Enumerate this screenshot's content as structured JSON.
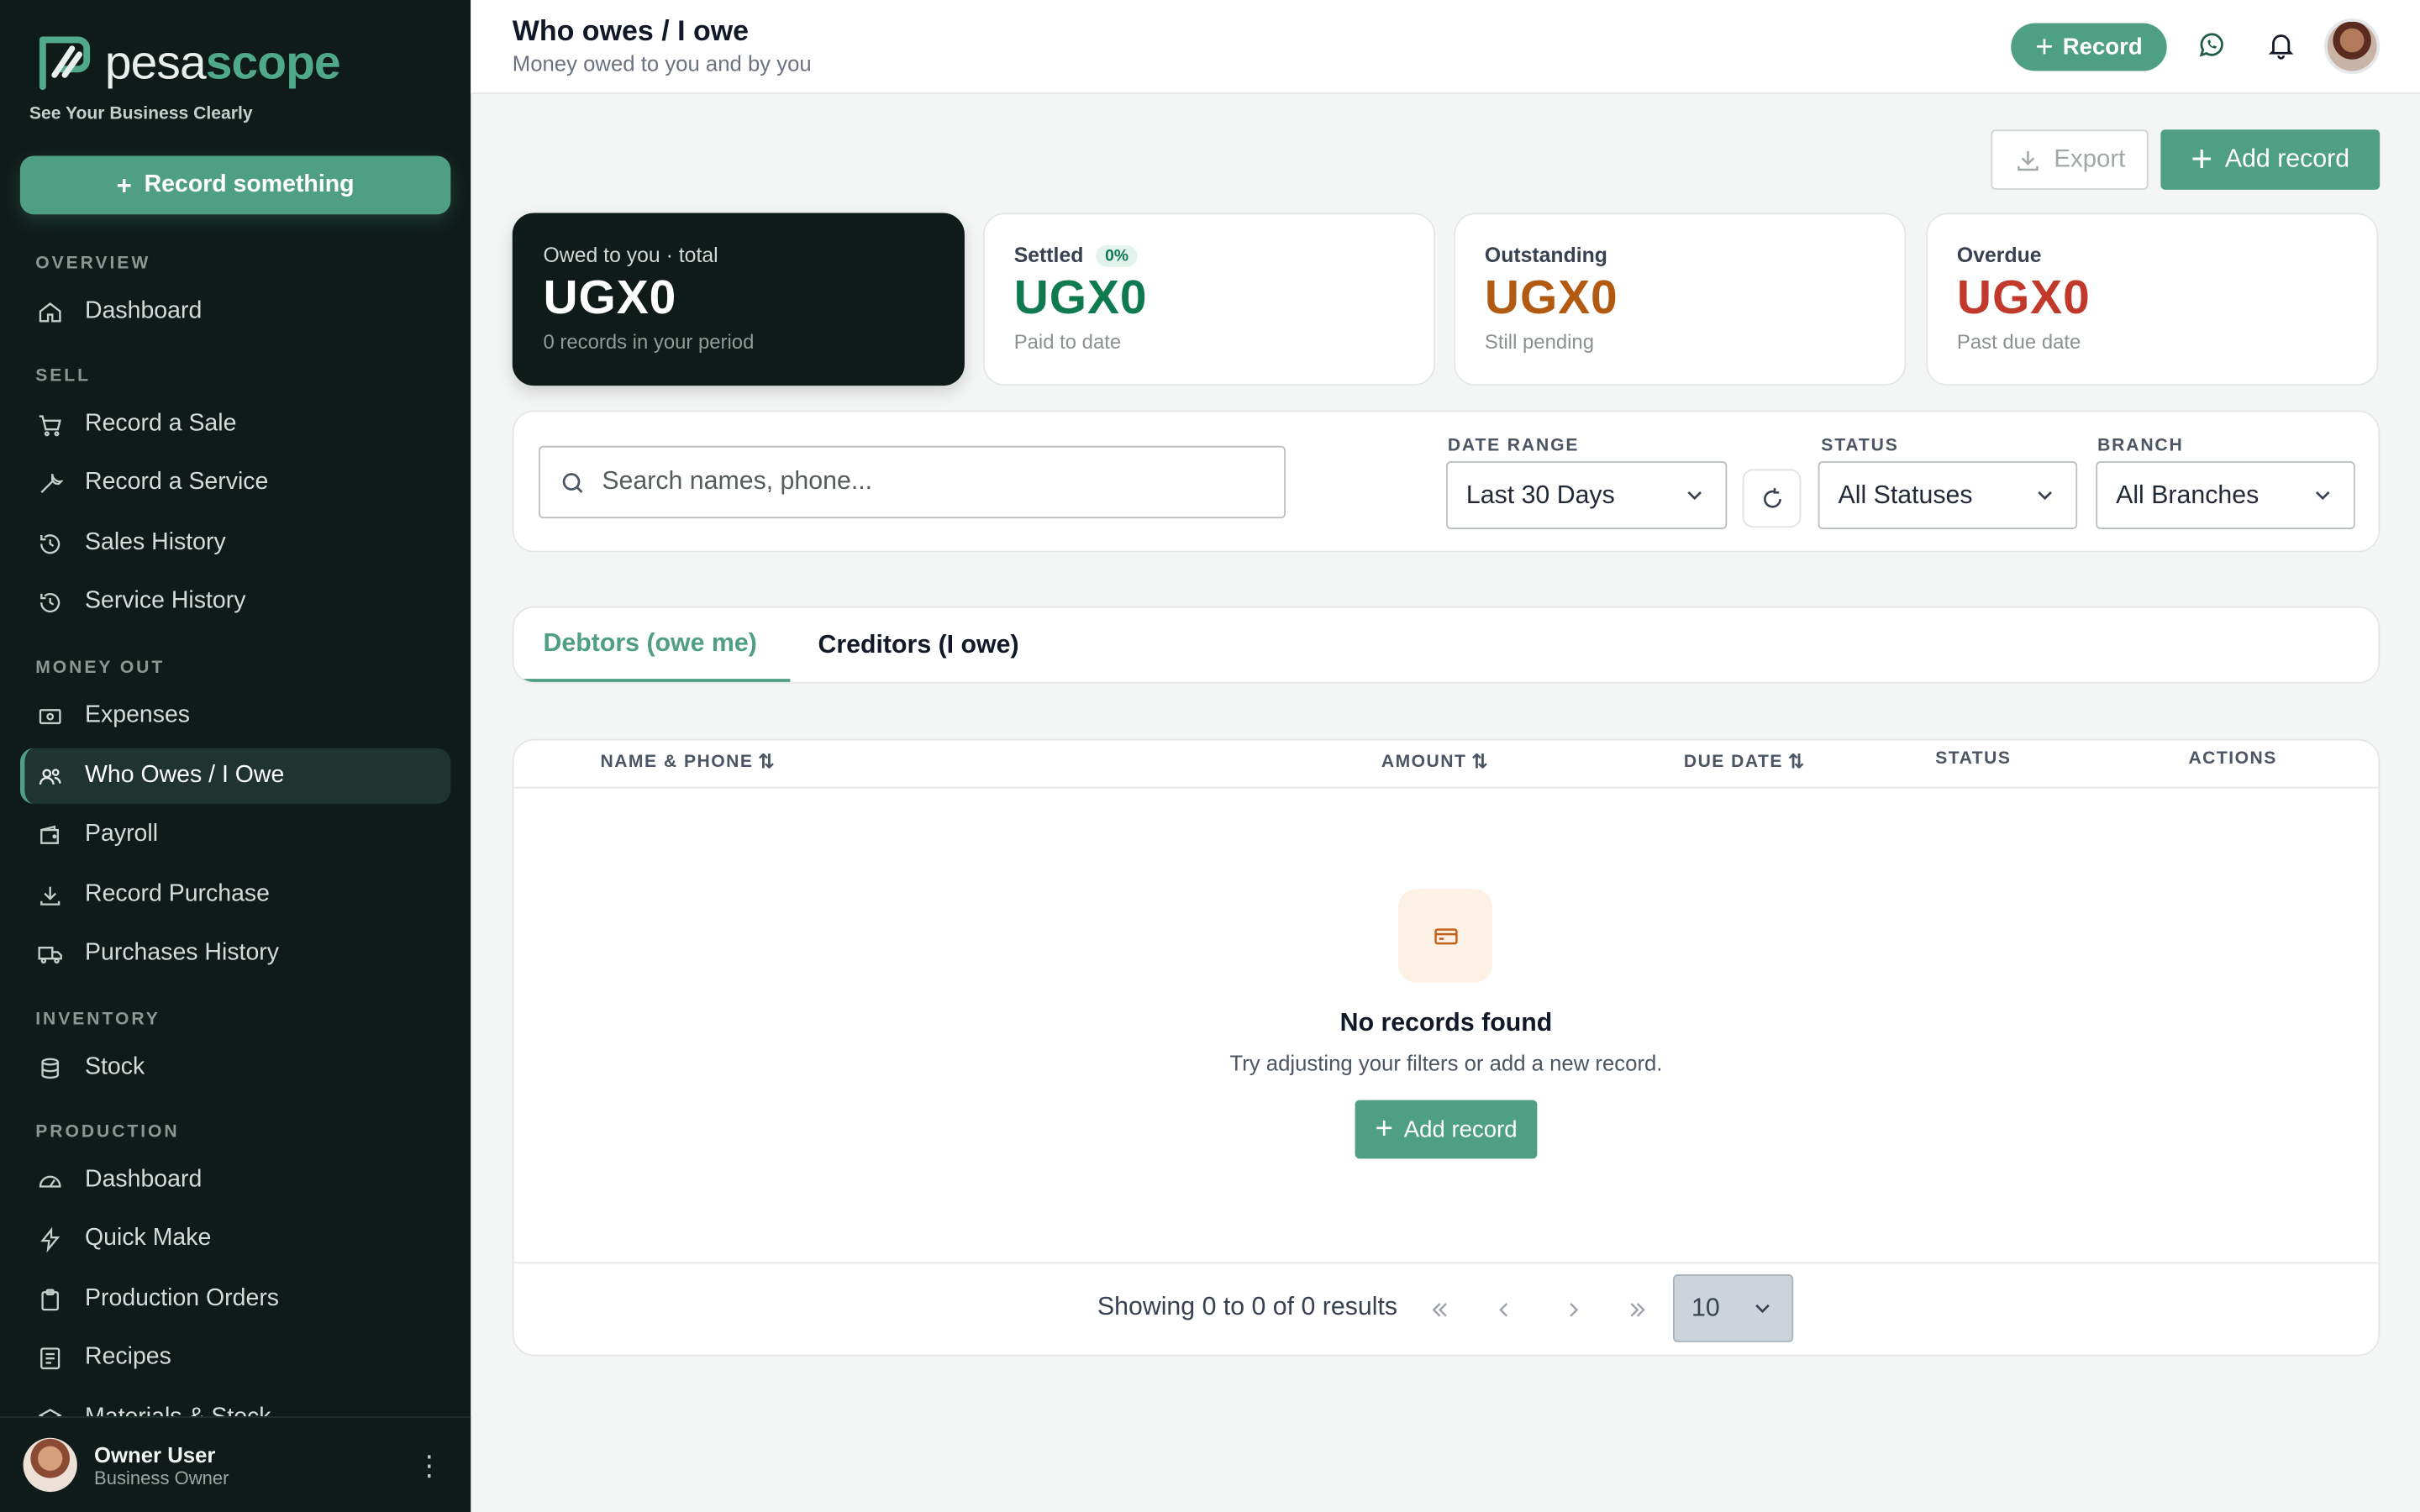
{
  "brand": {
    "name_part1": "pesa",
    "name_part2": "scope",
    "tagline": "See Your Business Clearly"
  },
  "sidebar": {
    "record_button": "Record something",
    "sections": [
      {
        "title": "OVERVIEW",
        "items": [
          {
            "label": "Dashboard",
            "icon": "home-icon"
          }
        ]
      },
      {
        "title": "SELL",
        "items": [
          {
            "label": "Record a Sale",
            "icon": "cart-icon"
          },
          {
            "label": "Record a Service",
            "icon": "wrench-icon"
          },
          {
            "label": "Sales History",
            "icon": "history-icon"
          },
          {
            "label": "Service History",
            "icon": "history-icon"
          }
        ]
      },
      {
        "title": "MONEY OUT",
        "items": [
          {
            "label": "Expenses",
            "icon": "cash-icon"
          },
          {
            "label": "Who Owes / I Owe",
            "icon": "users-icon",
            "active": true
          },
          {
            "label": "Payroll",
            "icon": "wallet-icon"
          },
          {
            "label": "Record Purchase",
            "icon": "download-icon"
          },
          {
            "label": "Purchases History",
            "icon": "truck-icon"
          }
        ]
      },
      {
        "title": "INVENTORY",
        "items": [
          {
            "label": "Stock",
            "icon": "database-icon"
          }
        ]
      },
      {
        "title": "PRODUCTION",
        "items": [
          {
            "label": "Dashboard",
            "icon": "gauge-icon"
          },
          {
            "label": "Quick Make",
            "icon": "bolt-icon"
          },
          {
            "label": "Production Orders",
            "icon": "clipboard-icon"
          },
          {
            "label": "Recipes",
            "icon": "list-icon"
          },
          {
            "label": "Materials & Stock",
            "icon": "layers-icon"
          }
        ]
      }
    ],
    "user": {
      "name": "Owner User",
      "role": "Business Owner"
    }
  },
  "header": {
    "title": "Who owes / I owe",
    "subtitle": "Money owed to you and by you",
    "record_button": "Record"
  },
  "actions": {
    "export": "Export",
    "add_record": "Add record"
  },
  "summary": [
    {
      "label": "Owed to you · total",
      "value": "UGX0",
      "sub": "0 records in your period",
      "color": "#ffffff"
    },
    {
      "label": "Settled",
      "badge": "0%",
      "value": "UGX0",
      "sub": "Paid to date",
      "color": "#0f7a4f"
    },
    {
      "label": "Outstanding",
      "value": "UGX0",
      "sub": "Still pending",
      "color": "#b35a12"
    },
    {
      "label": "Overdue",
      "value": "UGX0",
      "sub": "Past due date",
      "color": "#c0392b"
    }
  ],
  "filters": {
    "search_placeholder": "Search names, phone...",
    "date_range_label": "DATE RANGE",
    "date_range_value": "Last 30 Days",
    "status_label": "STATUS",
    "status_value": "All Statuses",
    "branch_label": "BRANCH",
    "branch_value": "All Branches"
  },
  "tabs": [
    {
      "label": "Debtors (owe me)",
      "active": true
    },
    {
      "label": "Creditors (I owe)",
      "active": false
    }
  ],
  "table": {
    "columns": [
      "NAME & PHONE",
      "AMOUNT",
      "DUE DATE",
      "STATUS",
      "ACTIONS"
    ],
    "empty_title": "No records found",
    "empty_sub": "Try adjusting your filters or add a new record.",
    "empty_add": "Add record",
    "showing": "Showing 0 to 0 of 0 results",
    "page_size": "10"
  },
  "colors": {
    "accent": "#4f9f84",
    "sidebar_bg": "#0f1b19"
  }
}
